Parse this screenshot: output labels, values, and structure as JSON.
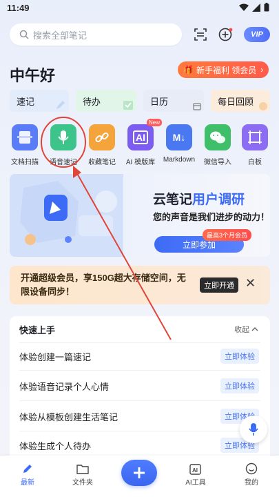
{
  "status": {
    "time": "11:49"
  },
  "search": {
    "placeholder": "搜索全部笔记"
  },
  "header": {
    "vip": "VIP"
  },
  "greeting": "中午好",
  "promo": {
    "label": "新手福利 领会员"
  },
  "quick_cards": [
    {
      "label": "速记"
    },
    {
      "label": "待办"
    },
    {
      "label": "日历"
    },
    {
      "label": "每日回顾"
    }
  ],
  "tools": [
    {
      "label": "文档扫描",
      "icon": "scan-icon",
      "color": "#5b7cf7"
    },
    {
      "label": "语音速记",
      "icon": "mic-icon",
      "color": "#3cc48a"
    },
    {
      "label": "收藏笔记",
      "icon": "link-icon",
      "color": "#f5a43b"
    },
    {
      "label": "AI 模版库",
      "icon": "ai-icon",
      "color": "#7d5cf1",
      "badge": "New"
    },
    {
      "label": "Markdown",
      "icon": "markdown-icon",
      "color": "#4a78f0"
    },
    {
      "label": "微信导入",
      "icon": "wechat-icon",
      "color": "#3fbf6a"
    },
    {
      "label": "白板",
      "icon": "whiteboard-icon",
      "color": "#8b6cf2"
    }
  ],
  "banner": {
    "title_part1": "云笔记",
    "title_part2": "用户调研",
    "subtitle": "您的声音是我们进步的动力！",
    "badge": "最高3个月会员",
    "button": "立即参加"
  },
  "member": {
    "text": "开通超级会员，享150G超大存储空间，无限设备同步！",
    "button": "立即开通",
    "close": "✕"
  },
  "guide": {
    "title": "快速上手",
    "collapse": "收起",
    "items": [
      {
        "label": "体验创建一篇速记",
        "button": "立即体验"
      },
      {
        "label": "体验语音记录个人心情",
        "button": "立即体验"
      },
      {
        "label": "体验从模板创建生活笔记",
        "button": "立即体验"
      },
      {
        "label": "体验生成个人待办",
        "button": "立即体验"
      }
    ]
  },
  "bottom_nav": [
    {
      "label": "最新",
      "icon": "latest-icon",
      "active": true
    },
    {
      "label": "文件夹",
      "icon": "folder-icon"
    },
    {
      "label": "AI工具",
      "icon": "ai-tool-icon"
    },
    {
      "label": "我的",
      "icon": "profile-icon"
    }
  ],
  "colors": {
    "accent": "#3c6cf6",
    "annotation": "#e0453a"
  }
}
